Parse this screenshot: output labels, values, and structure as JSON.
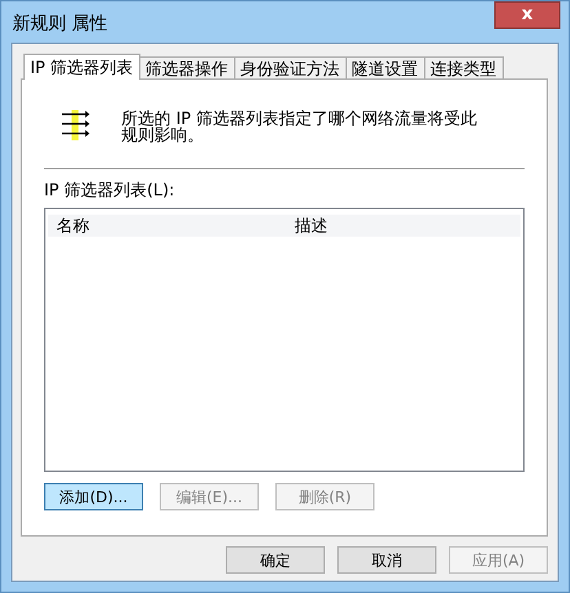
{
  "window": {
    "title": "新规则 属性",
    "close": "x"
  },
  "tabs": [
    {
      "label": "IP 筛选器列表",
      "selected": true
    },
    {
      "label": "筛选器操作",
      "selected": false
    },
    {
      "label": "身份验证方法",
      "selected": false
    },
    {
      "label": "隧道设置",
      "selected": false
    },
    {
      "label": "连接类型",
      "selected": false
    }
  ],
  "description": "所选的 IP 筛选器列表指定了哪个网络流量将受此规则影响。",
  "list": {
    "label": "IP 筛选器列表(L):",
    "columns": [
      "名称",
      "描述"
    ]
  },
  "list_buttons": [
    {
      "label": "添加(D)...",
      "disabled": false,
      "focused": true
    },
    {
      "label": "编辑(E)...",
      "disabled": true,
      "focused": false
    },
    {
      "label": "删除(R)",
      "disabled": true,
      "focused": false
    }
  ],
  "dialog_buttons": [
    {
      "label": "确定",
      "disabled": false
    },
    {
      "label": "取消",
      "disabled": false
    },
    {
      "label": "应用(A)",
      "disabled": true
    }
  ]
}
